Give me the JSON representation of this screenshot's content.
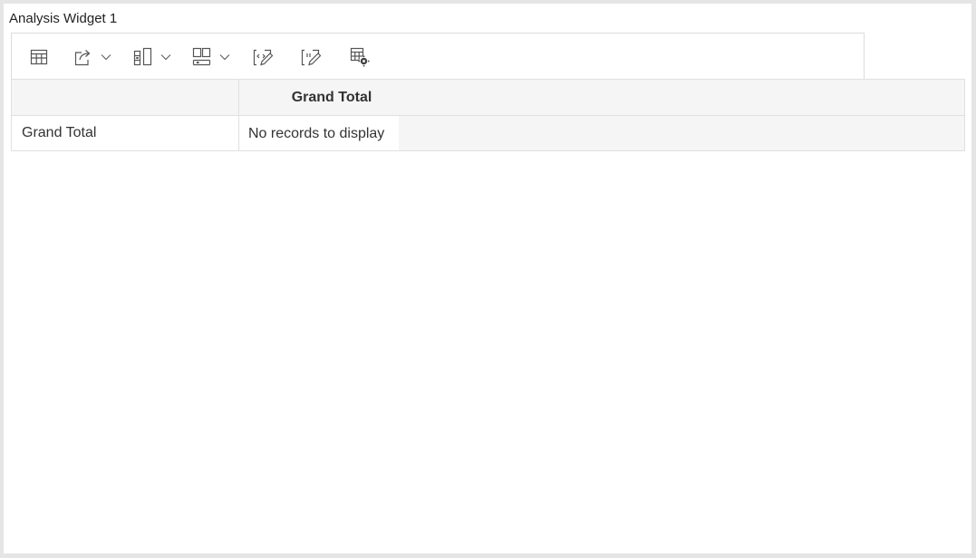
{
  "widget": {
    "title": "Analysis Widget 1"
  },
  "toolbar": {
    "buttons": [
      {
        "name": "table-view",
        "icon": "table-icon",
        "has_menu": false
      },
      {
        "name": "export",
        "icon": "share-export-icon",
        "has_menu": true
      },
      {
        "name": "column-layout",
        "icon": "column-layout-icon",
        "has_menu": true
      },
      {
        "name": "row-layout",
        "icon": "row-layout-icon",
        "has_menu": true
      },
      {
        "name": "edit-code",
        "icon": "edit-code-icon",
        "has_menu": false
      },
      {
        "name": "edit-values",
        "icon": "edit-values-icon",
        "has_menu": false
      },
      {
        "name": "table-settings",
        "icon": "table-settings-icon",
        "has_menu": false
      }
    ]
  },
  "grid": {
    "column_header": "Grand Total",
    "row_header": "Grand Total",
    "empty_message": "No records to display"
  },
  "colors": {
    "background": "#e5e5e5",
    "panel": "#ffffff",
    "header_fill": "#f5f5f5",
    "border": "#e0e0e0",
    "icon": "#555555"
  }
}
